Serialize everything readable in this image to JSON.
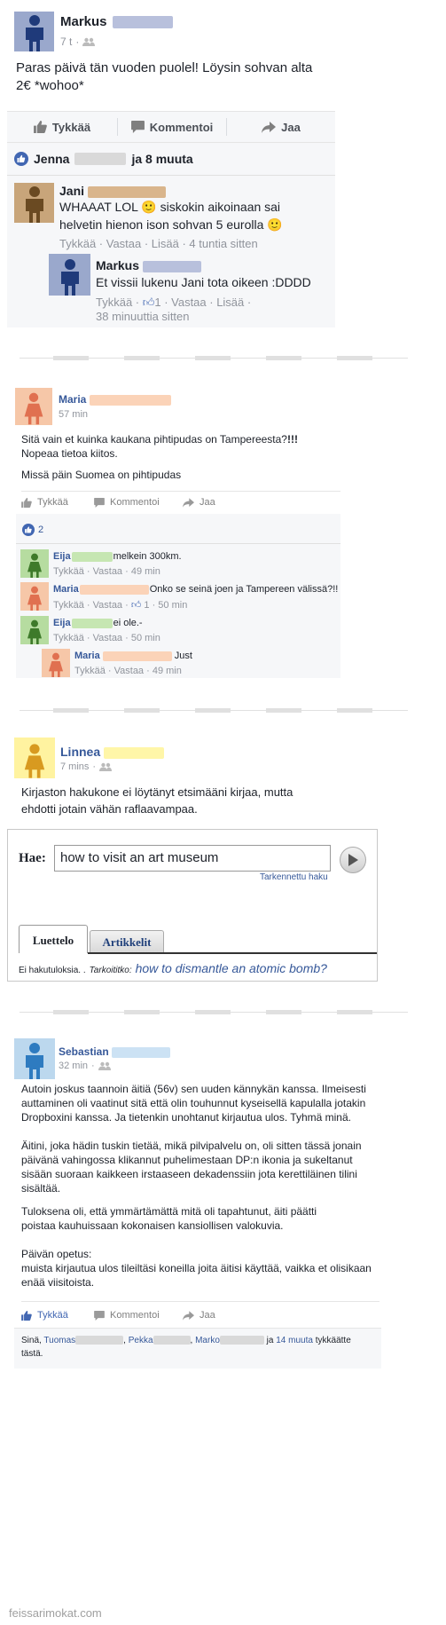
{
  "colors": {
    "blue_avatar": "#9aa8cc",
    "brown_avatar": "#c8a57a",
    "salmon_avatar": "#f6c7a8",
    "green_avatar": "#b6dca0",
    "yellow_avatar": "#fff3a0",
    "lightblue_avatar": "#bcd8ee",
    "like_blue": "#4267b2",
    "link_blue": "#365899"
  },
  "post1": {
    "author": "Markus",
    "time": "7 t",
    "audience_icon": "friends-icon",
    "text": "Paras päivä tän vuoden puolel! Löysin sohvan alta 2€ *wohoo*",
    "actions": {
      "like": "Tykkää",
      "comment": "Kommentoi",
      "share": "Jaa"
    },
    "likes": {
      "name": "Jenna",
      "rest": "ja 8 muuta"
    },
    "comments": [
      {
        "author": "Jani",
        "text": "WHAAAT LOL 🙂 siskokin aikoinaan sai helvetin hienon ison sohvan 5 eurolla 🙂",
        "meta": "Tykkää · Vastaa · Lisää · 4 tuntia sitten"
      },
      {
        "author": "Markus",
        "text": "Et vissii lukenu Jani tota oikeen :DDDD",
        "meta_a": "Tykkää · ",
        "meta_likes": "1",
        "meta_b": " · Vastaa · Lisää ·",
        "meta_time": "38 minuuttia sitten"
      }
    ]
  },
  "post2": {
    "author": "Maria",
    "time": "57 min",
    "text1a": "Sitä vain et kuinka kaukana pihtipudas on Tampereesta?",
    "text1b": "!!!",
    "text2": "Nopeaa tietoa kiitos.",
    "text3": "Missä päin Suomea on pihtipudas",
    "actions": {
      "like": "Tykkää",
      "comment": "Kommentoi",
      "share": "Jaa"
    },
    "like_count": "2",
    "comments": [
      {
        "author": "Eija",
        "text": "melkein 300km.",
        "meta": "Tykkää · Vastaa · 49 min"
      },
      {
        "author": "Maria",
        "text": "Onko se seinä joen ja Tampereen välissä?!!",
        "meta_a": "Tykkää · Vastaa · ",
        "meta_likes": "1",
        "meta_b": " · 50 min"
      },
      {
        "author": "Eija",
        "text": "ei ole.-",
        "meta": "Tykkää · Vastaa · 50 min"
      },
      {
        "author": "Maria",
        "text": "Just",
        "meta": "Tykkää · Vastaa · 49 min"
      }
    ]
  },
  "post3": {
    "author": "Linnea",
    "time": "7 mins",
    "text": "Kirjaston hakukone ei löytänyt etsimääni kirjaa, mutta ehdotti jotain vähän raflaavampaa.",
    "search": {
      "label": "Hae:",
      "value": "how to visit an art museum",
      "advanced": "Tarkennettu haku",
      "tab_list": "Luettelo",
      "tab_articles": "Artikkelit",
      "no_results": "Ei hakutuloksia. .",
      "did_you_mean": "Tarkoititko:",
      "suggestion": "how to dismantle an atomic bomb",
      "suggestion_end": "?"
    }
  },
  "post4": {
    "author": "Sebastian",
    "time": "32 min",
    "p1": "Autoin joskus taannoin äitiä (56v) sen uuden kännykän kanssa. Ilmeisesti auttaminen oli vaatinut sitä että olin touhunnut kyseisellä kapulalla jotakin Dropboxini kanssa. Ja tietenkin unohtanut kirjautua ulos. Tyhmä minä.",
    "p2": "Äitini, joka hädin tuskin tietää, mikä pilvipalvelu on, oli sitten tässä jonain päivänä vahingossa klikannut puhelimestaan DP:n ikonia ja sukeltanut sisään suoraan kaikkeen irstaaseen dekadenssiin jota kerettiläinen tilini sisältää.",
    "p3": "Tuloksena oli, että ymmärtämättä mitä oli tapahtunut, äiti päätti poistaa kauhuissaan kokonaisen kansiollisen valokuvia.",
    "p4a": "Päivän opetus:",
    "p4b": "muista kirjautua ulos tileiltäsi koneilla joita äitisi käyttää, vaikka et olisikaan enää viisitoista.",
    "actions": {
      "like": "Tykkää",
      "comment": "Kommentoi",
      "share": "Jaa"
    },
    "likes": {
      "you": "Sinä,",
      "n1": "Tuomas",
      "n2": "Pekka",
      "n3": "Marko",
      "and": "ja",
      "more": "14 muuta",
      "tail": "tykkäätte tästä."
    }
  },
  "watermark": "feissarimokat.com"
}
